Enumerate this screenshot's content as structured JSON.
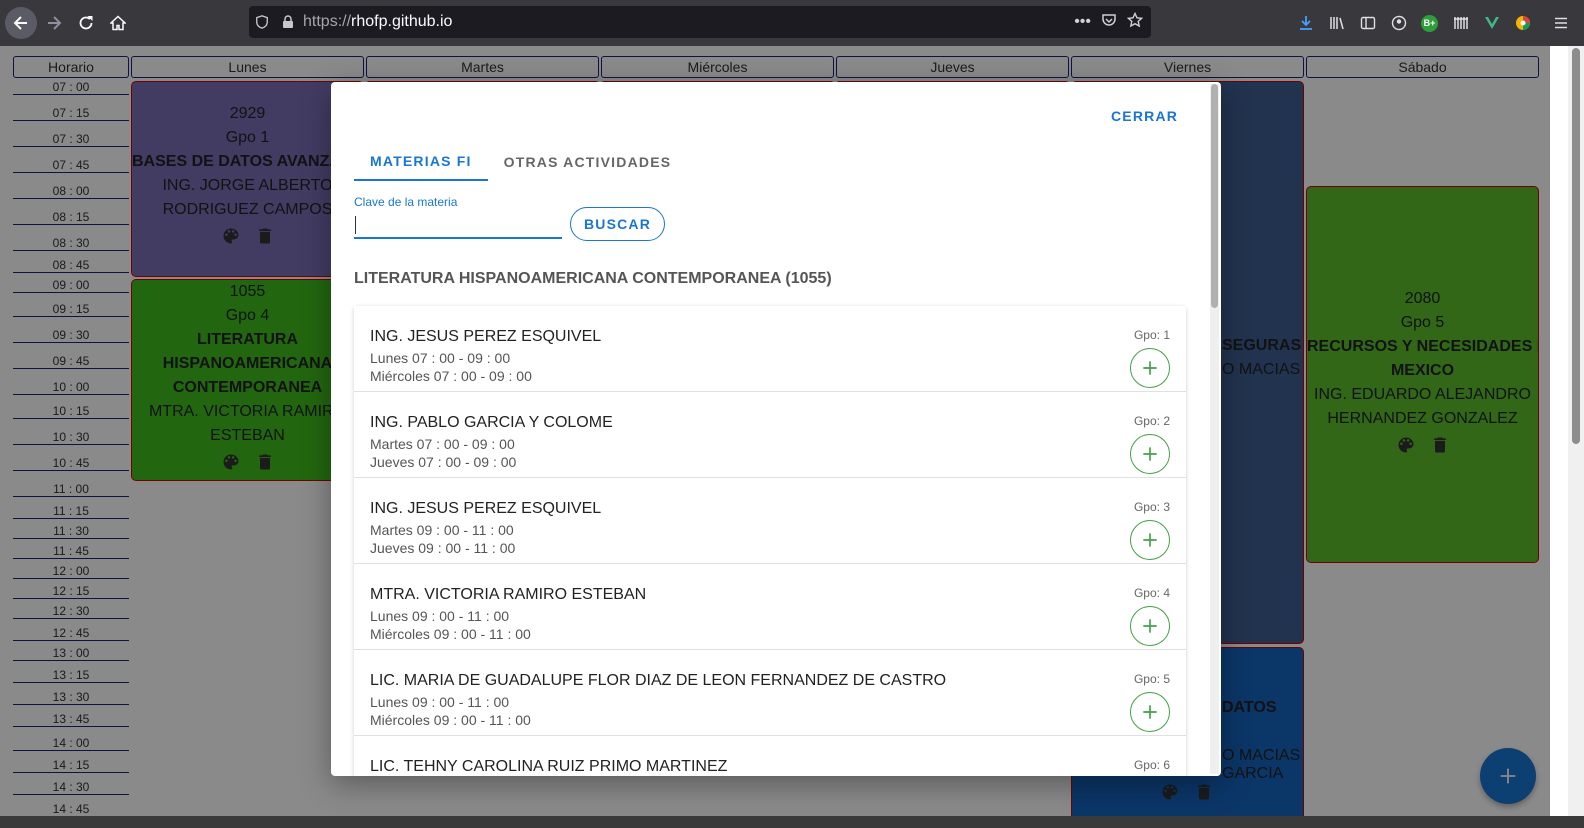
{
  "browser": {
    "url_dim": "https://",
    "url_host": "rhofp.github.io",
    "toolbar_badge": "B+"
  },
  "schedule": {
    "headers": [
      "Horario",
      "Lunes",
      "Martes",
      "Miércoles",
      "Jueves",
      "Viernes",
      "Sábado"
    ],
    "times": [
      "07 : 00",
      "07 : 15",
      "07 : 30",
      "07 : 45",
      "08 : 00",
      "08 : 15",
      "08 : 30",
      "08 : 45",
      "09 : 00",
      "09 : 15",
      "09 : 30",
      "09 : 45",
      "10 : 00",
      "10 : 15",
      "10 : 30",
      "10 : 45",
      "11 : 00",
      "11 : 15",
      "11 : 30",
      "11 : 45",
      "12 : 00",
      "12 : 15",
      "12 : 30",
      "12 : 45",
      "13 : 00",
      "13 : 15",
      "13 : 30",
      "13 : 45",
      "14 : 00",
      "14 : 15",
      "14 : 30",
      "14 : 45"
    ],
    "cards": {
      "lun1": {
        "code": "2929",
        "group": "Gpo 1",
        "name": "BASES DE DATOS AVANZADAS",
        "prof1": "ING. JORGE ALBERTO",
        "prof2": "RODRIGUEZ CAMPOS",
        "color": "#7b6fb8"
      },
      "lun2": {
        "code": "1055",
        "group": "Gpo 4",
        "name1": "LITERATURA",
        "name2": "HISPANOAMERICANA",
        "name3": "CONTEMPORANEA",
        "prof1": "MTRA. VICTORIA RAMIRO",
        "prof2": "ESTEBAN",
        "color": "#3fbf1c"
      },
      "vie1": {
        "name": "SEGURAS",
        "prof": "O MACIAS",
        "color": "#3f5e93"
      },
      "vie2": {
        "name": "DATOS",
        "prof1": "O MACIAS",
        "prof2": "GARCIA",
        "color": "#1565c0"
      },
      "sab1": {
        "code": "2080",
        "group": "Gpo 5",
        "name1": "RECURSOS Y NECESIDADES DE",
        "name2": "MEXICO",
        "prof1": "ING. EDUARDO ALEJANDRO",
        "prof2": "HERNANDEZ GONZALEZ",
        "color": "#5cbf2a"
      }
    }
  },
  "modal": {
    "close_label": "CERRAR",
    "tabs": [
      "MATERIAS FI",
      "OTRAS ACTIVIDADES"
    ],
    "field_label": "Clave de la materia",
    "field_value": "",
    "search_label": "BUSCAR",
    "subject_title": "LITERATURA HISPANOAMERICANA CONTEMPORANEA (1055)",
    "groups": [
      {
        "professor": "ING. JESUS PEREZ ESQUIVEL",
        "slot1": "Lunes 07 : 00 - 09 : 00",
        "slot2": "Miércoles 07 : 00 - 09 : 00",
        "group": "Gpo: 1"
      },
      {
        "professor": "ING. PABLO GARCIA Y COLOME",
        "slot1": "Martes 07 : 00 - 09 : 00",
        "slot2": "Jueves 07 : 00 - 09 : 00",
        "group": "Gpo: 2"
      },
      {
        "professor": "ING. JESUS PEREZ ESQUIVEL",
        "slot1": "Martes 09 : 00 - 11 : 00",
        "slot2": "Jueves 09 : 00 - 11 : 00",
        "group": "Gpo: 3"
      },
      {
        "professor": "MTRA. VICTORIA RAMIRO ESTEBAN",
        "slot1": "Lunes 09 : 00 - 11 : 00",
        "slot2": "Miércoles 09 : 00 - 11 : 00",
        "group": "Gpo: 4"
      },
      {
        "professor": "LIC. MARIA DE GUADALUPE FLOR DIAZ DE LEON FERNANDEZ DE CASTRO",
        "slot1": "Lunes 09 : 00 - 11 : 00",
        "slot2": "Miércoles 09 : 00 - 11 : 00",
        "group": "Gpo: 5"
      },
      {
        "professor": "LIC. TEHNY CAROLINA RUIZ PRIMO MARTINEZ",
        "slot1": "",
        "slot2": "",
        "group": "Gpo: 6"
      }
    ]
  },
  "colors": {
    "accent": "#1976d2",
    "add": "#43a047",
    "border": "#1a237e"
  }
}
